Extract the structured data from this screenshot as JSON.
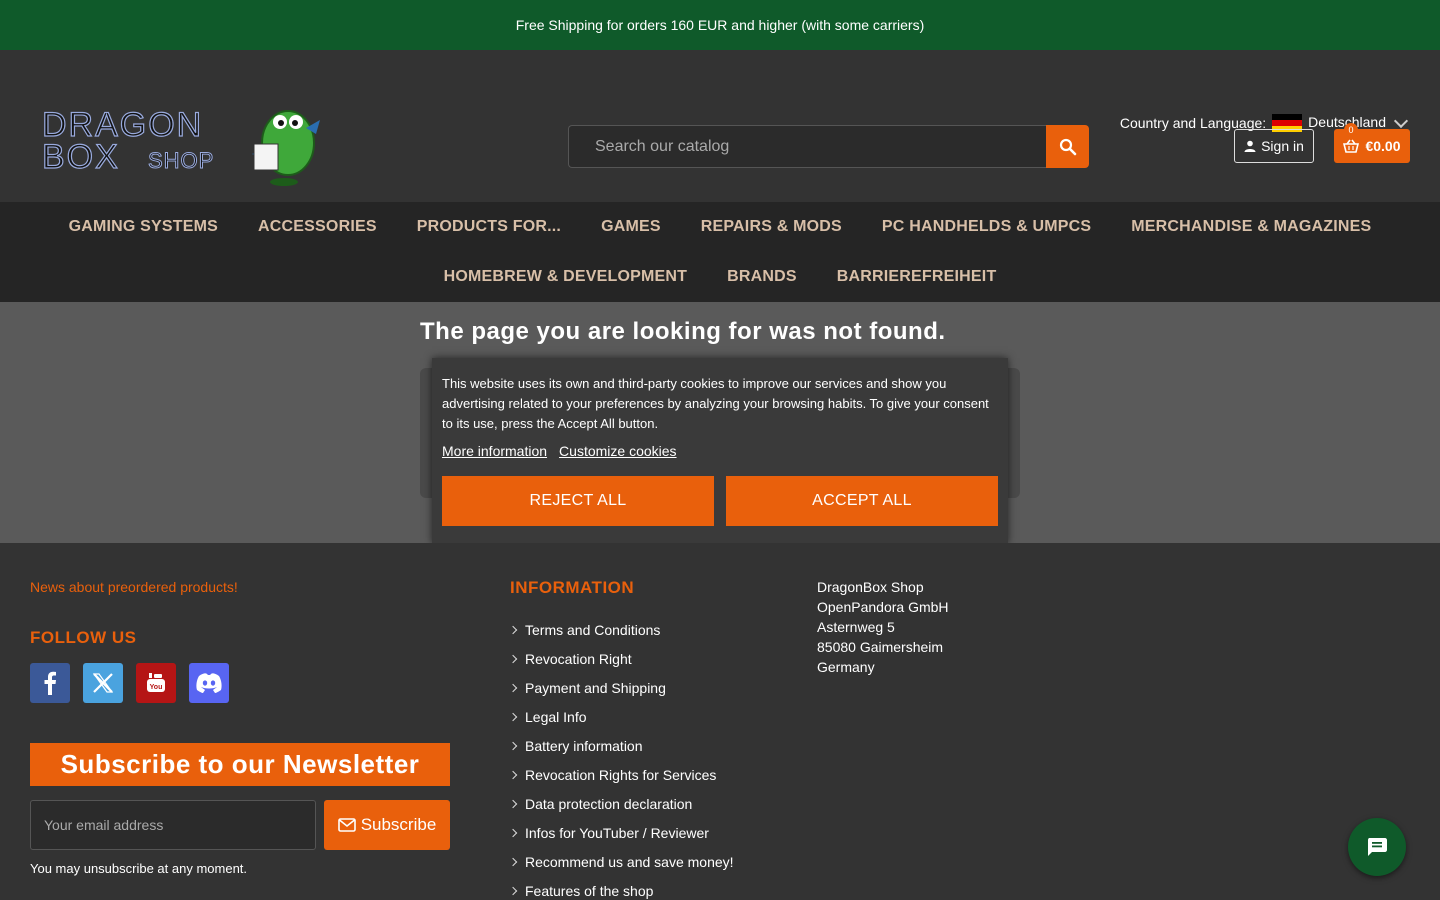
{
  "topbar": {
    "text": "Free Shipping for orders 160 EUR and higher (with some carriers)"
  },
  "header": {
    "country_label": "Country and Language:",
    "country_value": "Deutschland",
    "logo_text_line1": "DRAGON",
    "logo_text_line2": "BOX",
    "logo_text_line3": "SHOP",
    "search_placeholder": "Search our catalog",
    "signin_label": "Sign in",
    "cart_total": "€0.00",
    "cart_count": "0"
  },
  "nav": {
    "row1": [
      "GAMING SYSTEMS",
      "ACCESSORIES",
      "PRODUCTS FOR...",
      "GAMES",
      "REPAIRS & MODS",
      "PC HANDHELDS & UMPCS",
      "MERCHANDISE & MAGAZINES"
    ],
    "row2": [
      "HOMEBREW & DEVELOPMENT",
      "BRANDS",
      "BARRIEREFREIHEIT"
    ]
  },
  "main": {
    "title": "The page you are looking for was not found."
  },
  "cookie": {
    "text": "This website uses its own and third-party cookies to improve our services and show you advertising related to your preferences by analyzing your browsing habits. To give your consent to its use, press the Accept All button.",
    "more_info": "More information",
    "customize": "Customize cookies",
    "reject": "REJECT ALL",
    "accept": "ACCEPT ALL"
  },
  "footer": {
    "news_link": "News about preordered products!",
    "follow_title": "FOLLOW US",
    "socials": [
      "facebook-icon",
      "x-icon",
      "youtube-icon",
      "discord-icon"
    ],
    "newsletter_title": "Subscribe to our Newsletter",
    "email_placeholder": "Your email address",
    "subscribe_label": "Subscribe",
    "unsubscribe_text": "You may unsubscribe at any moment.",
    "info_title": "INFORMATION",
    "info_links": [
      "Terms and Conditions",
      "Revocation Right",
      "Payment and Shipping",
      "Legal Info",
      "Battery information",
      "Revocation Rights for Services",
      "Data protection declaration",
      "Infos for YouTuber / Reviewer",
      "Recommend us and save money!",
      "Features of the shop"
    ],
    "address": [
      "DragonBox Shop",
      "OpenPandora GmbH",
      "Asternweg 5",
      "85080 Gaimersheim",
      "Germany"
    ]
  },
  "colors": {
    "accent": "#e9600c",
    "topbar": "#0f5a2a",
    "background": "#333333"
  }
}
